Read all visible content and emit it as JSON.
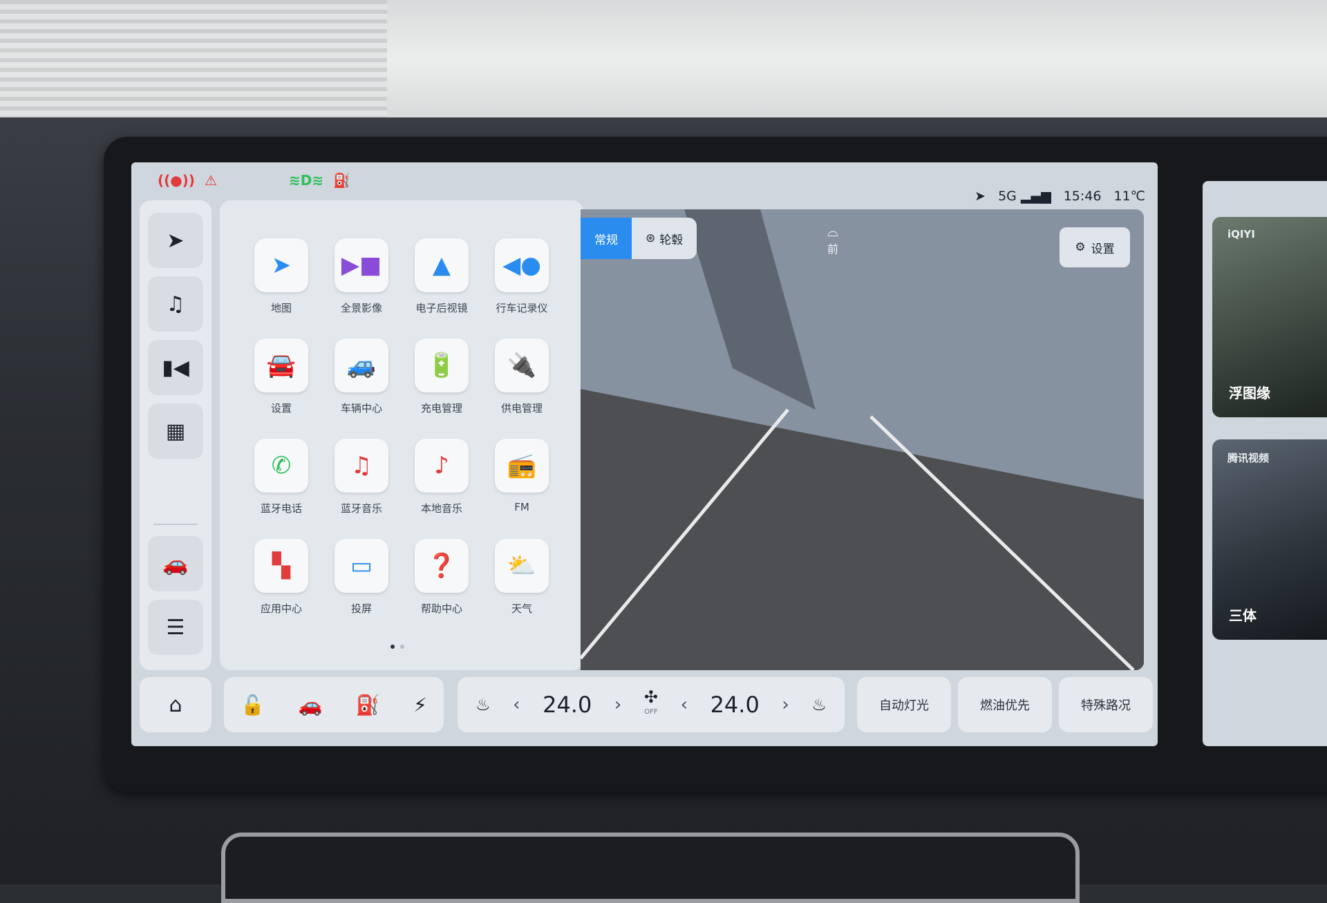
{
  "status_bar": {
    "indicators": [
      "brake-warning-icon",
      "seatbelt-warning-icon",
      "headlight-icon",
      "fuel-warning-icon"
    ],
    "network": "5G",
    "time": "15:46",
    "temperature": "11℃"
  },
  "nav_rail": [
    "navigation-icon",
    "music-icon",
    "camera-icon",
    "apps-grid-icon",
    "car-icon",
    "toggle-settings-icon"
  ],
  "launcher": {
    "apps": [
      {
        "label": "地图",
        "icon": "map-icon"
      },
      {
        "label": "全景影像",
        "icon": "panorama-camera-icon"
      },
      {
        "label": "电子后视镜",
        "icon": "mirror-icon"
      },
      {
        "label": "行车记录仪",
        "icon": "dashcam-icon"
      },
      {
        "label": "设置",
        "icon": "settings-car-icon"
      },
      {
        "label": "车辆中心",
        "icon": "vehicle-center-icon"
      },
      {
        "label": "充电管理",
        "icon": "battery-charge-icon"
      },
      {
        "label": "供电管理",
        "icon": "power-plug-icon"
      },
      {
        "label": "蓝牙电话",
        "icon": "phone-icon"
      },
      {
        "label": "蓝牙音乐",
        "icon": "bluetooth-music-icon"
      },
      {
        "label": "本地音乐",
        "icon": "local-music-icon"
      },
      {
        "label": "FM",
        "icon": "radio-icon"
      },
      {
        "label": "应用中心",
        "icon": "app-store-icon"
      },
      {
        "label": "投屏",
        "icon": "screen-cast-icon"
      },
      {
        "label": "帮助中心",
        "icon": "help-icon"
      },
      {
        "label": "天气",
        "icon": "weather-icon"
      }
    ],
    "page_count": 2,
    "current_page": 1
  },
  "camera": {
    "modes": [
      "常规",
      "轮毂"
    ],
    "active_mode": "常规",
    "front_label": "前",
    "settings_label": "设置"
  },
  "dock": {
    "home_icon": "home-icon",
    "quick_actions": [
      "unlock-icon",
      "car-side-icon",
      "fuel-nozzle-icon",
      "lightning-icon"
    ],
    "climate": {
      "left_temp": "24.0",
      "right_temp": "24.0",
      "fan_state": "OFF"
    },
    "buttons": [
      "自动灯光",
      "燃油优先",
      "特殊路况"
    ]
  },
  "media": {
    "cards": [
      {
        "brand": "iQIYI",
        "title": "浮图缘"
      },
      {
        "brand": "腾讯视频",
        "title": "三体"
      }
    ]
  },
  "colors": {
    "accent": "#2b8cf0",
    "warning_red": "#e23b3b",
    "indicator_green": "#2fbf5b",
    "indicator_orange": "#f08a24"
  }
}
